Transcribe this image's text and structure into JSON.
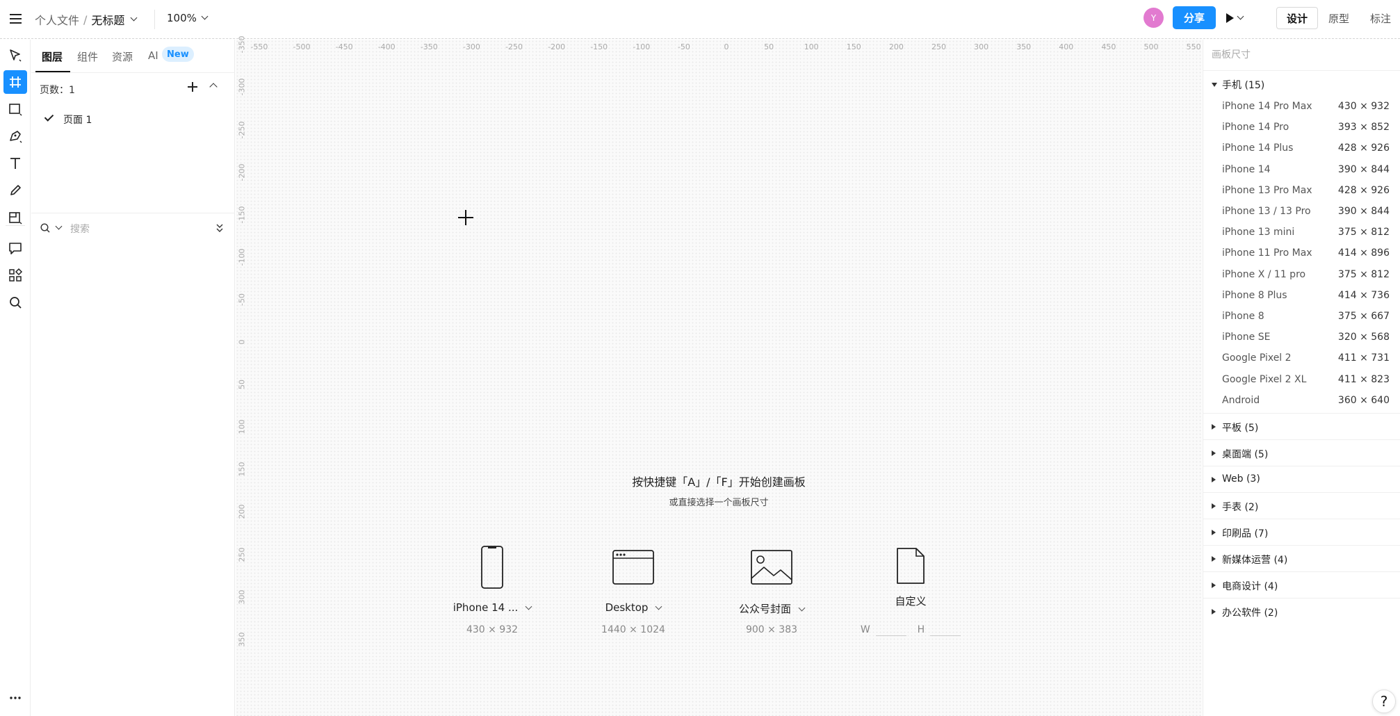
{
  "topbar": {
    "folder": "个人文件",
    "separator": "/",
    "file_title": "无标题",
    "zoom": "100%",
    "avatar_initial": "Y",
    "share_label": "分享",
    "mode_tabs": [
      "设计",
      "原型",
      "标注"
    ],
    "active_mode": "设计"
  },
  "left_panel": {
    "tabs": [
      "图层",
      "组件",
      "资源",
      "AI"
    ],
    "new_badge": "New",
    "pages_label": "页数：1",
    "pages": [
      {
        "label": "页面 1",
        "selected": true
      }
    ],
    "search_placeholder": "搜索"
  },
  "canvas": {
    "ruler_top": [
      "-550",
      "-500",
      "-450",
      "-400",
      "-350",
      "-300",
      "-250",
      "-200",
      "-150",
      "-100",
      "-50",
      "0",
      "50",
      "100",
      "150",
      "200",
      "250",
      "300",
      "350",
      "400",
      "450",
      "500",
      "550"
    ],
    "ruler_left": [
      "-350",
      "-300",
      "-250",
      "-200",
      "-150",
      "-100",
      "-50",
      "0",
      "50",
      "100",
      "150",
      "200",
      "250",
      "300",
      "350"
    ],
    "hint_title": "按快捷键「A」/「F」开始创建画板",
    "hint_subtitle": "或直接选择一个画板尺寸",
    "presets": [
      {
        "name": "iPhone 14 ...",
        "size": "430 × 932",
        "icon": "phone-icon"
      },
      {
        "name": "Desktop",
        "size": "1440 × 1024",
        "icon": "browser-window-icon"
      },
      {
        "name": "公众号封面",
        "size": "900 × 383",
        "icon": "image-icon"
      },
      {
        "name": "自定义",
        "w_label": "W",
        "h_label": "H",
        "icon": "document-icon"
      }
    ]
  },
  "right_panel": {
    "title": "画板尺寸",
    "groups": [
      {
        "label": "手机 (15)",
        "expanded": true,
        "items": [
          {
            "name": "iPhone 14 Pro Max",
            "size": "430 × 932"
          },
          {
            "name": "iPhone 14 Pro",
            "size": "393 × 852"
          },
          {
            "name": "iPhone 14 Plus",
            "size": "428 × 926"
          },
          {
            "name": "iPhone 14",
            "size": "390 × 844"
          },
          {
            "name": "iPhone 13 Pro Max",
            "size": "428 × 926"
          },
          {
            "name": "iPhone 13 / 13 Pro",
            "size": "390 × 844"
          },
          {
            "name": "iPhone 13 mini",
            "size": "375 × 812"
          },
          {
            "name": "iPhone 11 Pro Max",
            "size": "414 × 896"
          },
          {
            "name": "iPhone X / 11 pro",
            "size": "375 × 812"
          },
          {
            "name": "iPhone 8 Plus",
            "size": "414 × 736"
          },
          {
            "name": "iPhone 8",
            "size": "375 × 667"
          },
          {
            "name": "iPhone SE",
            "size": "320 × 568"
          },
          {
            "name": "Google Pixel 2",
            "size": "411 × 731"
          },
          {
            "name": "Google Pixel 2 XL",
            "size": "411 × 823"
          },
          {
            "name": "Android",
            "size": "360 × 640"
          }
        ]
      },
      {
        "label": "平板 (5)",
        "expanded": false
      },
      {
        "label": "桌面端 (5)",
        "expanded": false
      },
      {
        "label": "Web (3)",
        "expanded": false
      },
      {
        "label": "手表 (2)",
        "expanded": false
      },
      {
        "label": "印刷品 (7)",
        "expanded": false
      },
      {
        "label": "新媒体运营 (4)",
        "expanded": false
      },
      {
        "label": "电商设计 (4)",
        "expanded": false
      },
      {
        "label": "办公软件 (2)",
        "expanded": false
      }
    ]
  },
  "help_label": "?",
  "colors": {
    "accent": "#1890ff",
    "avatar": "#e27ad0",
    "new_badge_bg": "#dcefff"
  }
}
